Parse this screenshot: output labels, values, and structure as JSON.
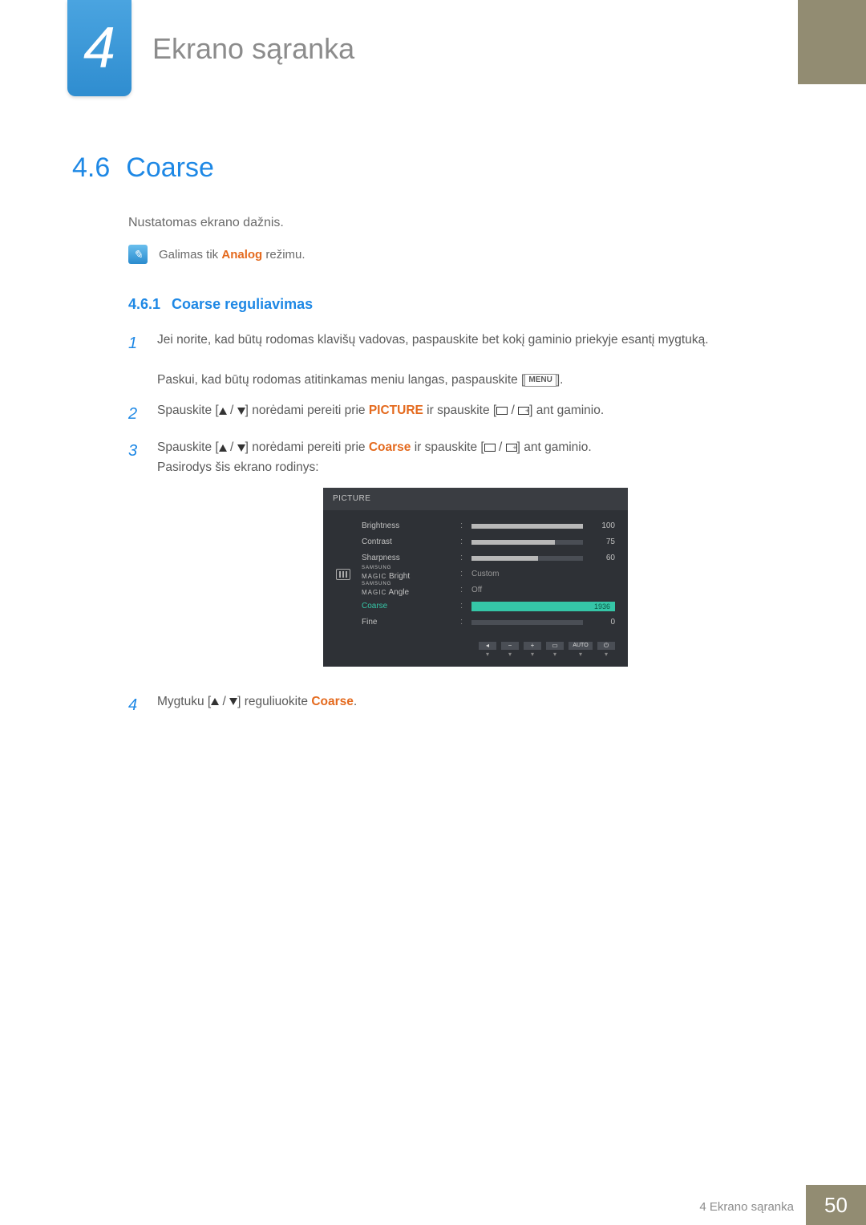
{
  "chapter": {
    "number": "4",
    "title": "Ekrano sąranka"
  },
  "section": {
    "number": "4.6",
    "title": "Coarse"
  },
  "intro": "Nustatomas ekrano dažnis.",
  "note": {
    "prefix": "Galimas tik ",
    "highlight": "Analog",
    "suffix": " režimu."
  },
  "subsection": {
    "number": "4.6.1",
    "title": "Coarse reguliavimas"
  },
  "steps": {
    "s1": {
      "line1": "Jei norite, kad būtų rodomas klavišų vadovas, paspauskite bet kokį gaminio priekyje esantį mygtuką.",
      "line2_a": "Paskui, kad būtų rodomas atitinkamas meniu langas, paspauskite [",
      "menu_label": "MENU",
      "line2_b": "]."
    },
    "s2": {
      "a": "Spauskite [",
      "b": "] norėdami pereiti prie ",
      "picture": "PICTURE",
      "c": " ir spauskite [",
      "d": "] ant gaminio."
    },
    "s3": {
      "a": "Spauskite [",
      "b": "] norėdami pereiti prie ",
      "coarse": "Coarse",
      "c": " ir spauskite [",
      "d": "] ant gaminio.",
      "e": "Pasirodys šis ekrano rodinys:"
    },
    "s4": {
      "a": "Mygtuku [",
      "b": "] reguliuokite ",
      "coarse": "Coarse",
      "c": "."
    }
  },
  "osd": {
    "title": "PICTURE",
    "rows": {
      "brightness": {
        "label": "Brightness",
        "value": 100,
        "pct": 100
      },
      "contrast": {
        "label": "Contrast",
        "value": 75,
        "pct": 75
      },
      "sharpness": {
        "label": "Sharpness",
        "value": 60,
        "pct": 60
      },
      "magicbright": {
        "brand": "SAMSUNG",
        "sub": "MAGIC",
        "suffix": "Bright",
        "value": "Custom"
      },
      "magicangle": {
        "brand": "SAMSUNG",
        "sub": "MAGIC",
        "suffix": "Angle",
        "value": "Off"
      },
      "coarse": {
        "label": "Coarse",
        "value": "1936"
      },
      "fine": {
        "label": "Fine",
        "value": 0,
        "pct": 0
      }
    },
    "footer_auto": "AUTO"
  },
  "footer": {
    "text": "4 Ekrano sąranka",
    "page": "50"
  }
}
